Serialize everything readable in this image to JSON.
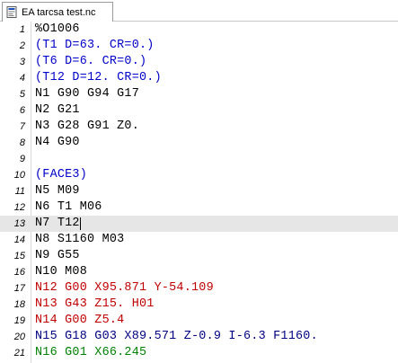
{
  "tab": {
    "label": "EA tarcsa test.nc",
    "icon": "nc-file-icon"
  },
  "colors": {
    "default": "#000000",
    "comment": "#0000c8",
    "red": "#c00000",
    "darkblue": "#000080",
    "green": "#008000",
    "current_line_bg": "#e6e6e6"
  },
  "editor": {
    "current_line": 13,
    "lines": [
      {
        "num": "1",
        "text": "%O1006",
        "color": "default"
      },
      {
        "num": "2",
        "text": "(T1 D=63. CR=0.)",
        "color": "comment"
      },
      {
        "num": "3",
        "text": "(T6 D=6. CR=0.)",
        "color": "comment"
      },
      {
        "num": "4",
        "text": "(T12 D=12. CR=0.)",
        "color": "comment"
      },
      {
        "num": "5",
        "text": "N1 G90 G94 G17",
        "color": "default"
      },
      {
        "num": "6",
        "text": "N2 G21",
        "color": "default"
      },
      {
        "num": "7",
        "text": "N3 G28 G91 Z0.",
        "color": "default"
      },
      {
        "num": "8",
        "text": "N4 G90",
        "color": "default"
      },
      {
        "num": "9",
        "text": "",
        "color": "default"
      },
      {
        "num": "10",
        "text": "(FACE3)",
        "color": "comment"
      },
      {
        "num": "11",
        "text": "N5 M09",
        "color": "default"
      },
      {
        "num": "12",
        "text": "N6 T1 M06",
        "color": "default"
      },
      {
        "num": "13",
        "text": "N7 T12",
        "color": "default"
      },
      {
        "num": "14",
        "text": "N8 S1160 M03",
        "color": "default"
      },
      {
        "num": "15",
        "text": "N9 G55",
        "color": "default"
      },
      {
        "num": "16",
        "text": "N10 M08",
        "color": "default"
      },
      {
        "num": "17",
        "text": "N12 G00 X95.871 Y-54.109",
        "color": "red"
      },
      {
        "num": "18",
        "text": "N13 G43 Z15. H01",
        "color": "red"
      },
      {
        "num": "19",
        "text": "N14 G00 Z5.4",
        "color": "red"
      },
      {
        "num": "20",
        "text": "N15 G18 G03 X89.571 Z-0.9 I-6.3 F1160.",
        "color": "darkblue"
      },
      {
        "num": "21",
        "text": "N16 G01 X66.245",
        "color": "green"
      }
    ]
  }
}
